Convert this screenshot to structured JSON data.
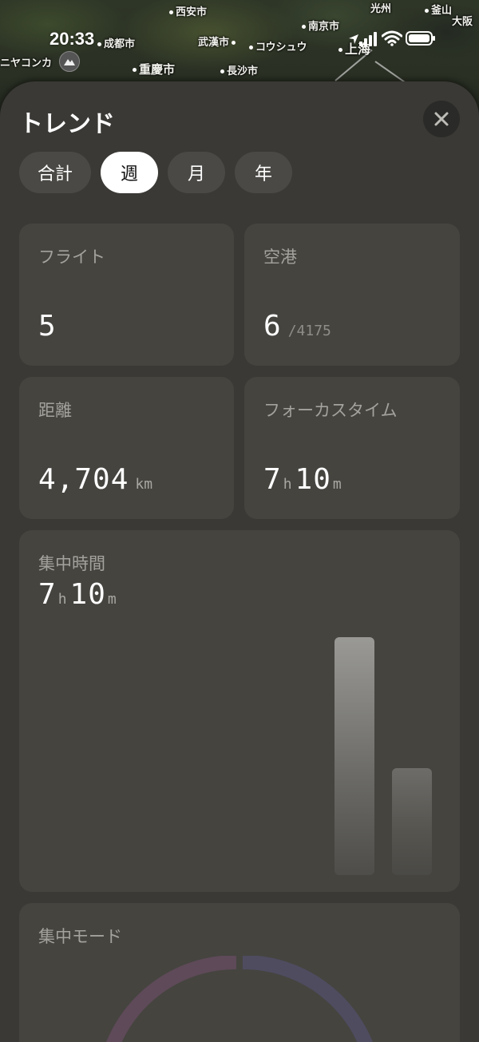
{
  "status_bar": {
    "time": "20:33"
  },
  "map": {
    "labels": {
      "xian": "西安市",
      "chengdu": "成都市",
      "wuhan": "武漢市",
      "nanjing": "南京市",
      "guangzhou": "光州",
      "busan": "釜山",
      "osaka": "大阪",
      "chongqing": "重慶市",
      "hangzhou": "コウシュウ",
      "shanghai": "上海",
      "changsha": "長沙市",
      "nyainqentangla": "ニヤコンカ"
    }
  },
  "sheet": {
    "title": "トレンド",
    "tabs": [
      {
        "label": "合計",
        "selected": false
      },
      {
        "label": "週",
        "selected": true
      },
      {
        "label": "月",
        "selected": false
      },
      {
        "label": "年",
        "selected": false
      }
    ],
    "stats": {
      "flights": {
        "label": "フライト",
        "value": "5"
      },
      "airports": {
        "label": "空港",
        "value": "6",
        "total": "/4175"
      },
      "distance": {
        "label": "距離",
        "value": "4,704",
        "unit": "km"
      },
      "focus_time": {
        "label": "フォーカスタイム",
        "hours": "7",
        "hours_unit": "h",
        "minutes": "10",
        "minutes_unit": "m"
      }
    },
    "focus_hours": {
      "label": "集中時間",
      "hours": "7",
      "hours_unit": "h",
      "minutes": "10",
      "minutes_unit": "m",
      "bars": [
        {
          "relative_value": 1.0
        },
        {
          "relative_value": 0.45
        }
      ]
    },
    "focus_mode": {
      "label": "集中モード"
    }
  },
  "colors": {
    "sheet_bg": "#3a3935",
    "card_bg": "#45443f",
    "tab_selected_bg": "#ffffff",
    "ring_left": "#5e4a58",
    "ring_right": "#4f4c60"
  }
}
